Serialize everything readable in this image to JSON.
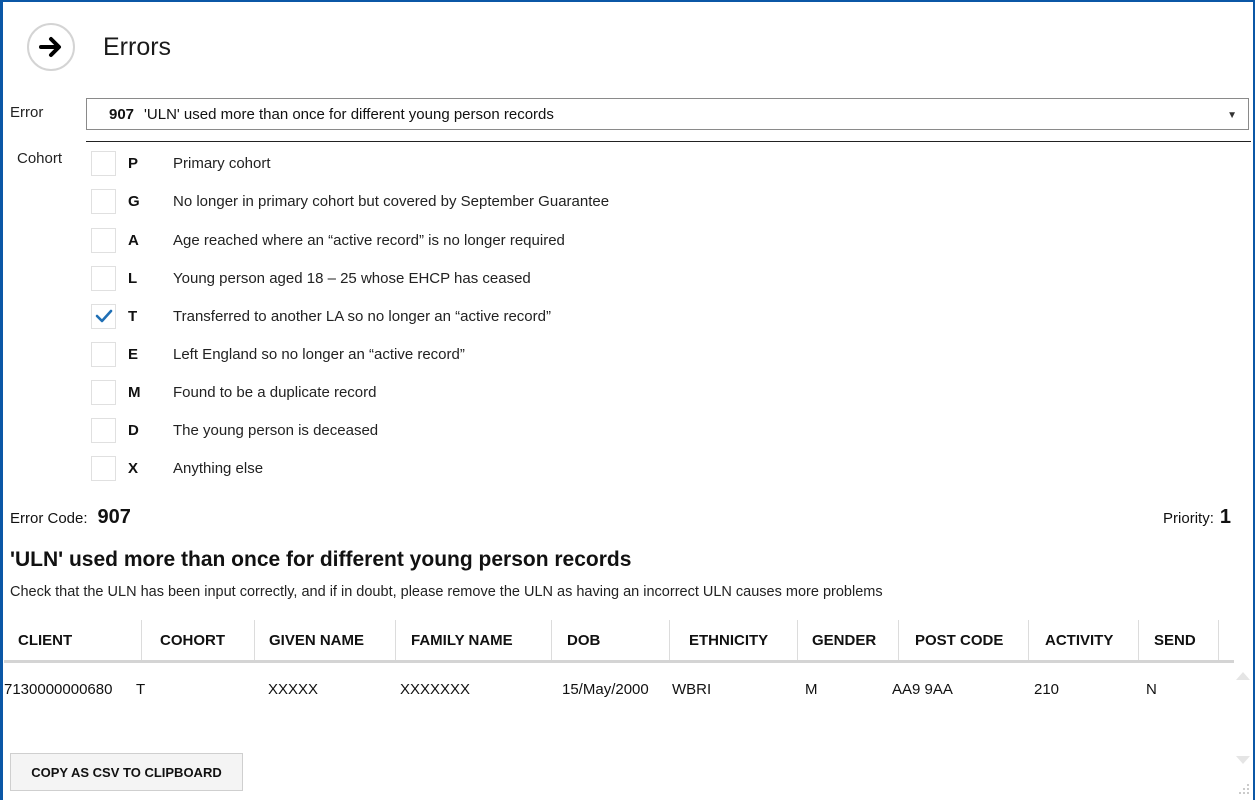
{
  "header": {
    "title": "Errors"
  },
  "error_field": {
    "label": "Error",
    "code": "907",
    "text": "'ULN' used more than once for different young person records"
  },
  "cohort": {
    "label": "Cohort",
    "items": [
      {
        "code": "P",
        "desc": "Primary cohort",
        "checked": false
      },
      {
        "code": "G",
        "desc": "No longer in primary cohort but covered by September Guarantee",
        "checked": false
      },
      {
        "code": "A",
        "desc": "Age reached where an “active record” is no longer required",
        "checked": false
      },
      {
        "code": "L",
        "desc": "Young person aged 18 – 25 whose EHCP has ceased",
        "checked": false
      },
      {
        "code": "T",
        "desc": "Transferred to another LA so no longer an “active record”",
        "checked": true
      },
      {
        "code": "E",
        "desc": "Left England so no longer an “active record”",
        "checked": false
      },
      {
        "code": "M",
        "desc": "Found to be a duplicate record",
        "checked": false
      },
      {
        "code": "D",
        "desc": "The young person is deceased",
        "checked": false
      },
      {
        "code": "X",
        "desc": "Anything else",
        "checked": false
      }
    ]
  },
  "details": {
    "error_code_label": "Error Code:",
    "error_code_value": "907",
    "priority_label": "Priority:",
    "priority_value": "1",
    "heading": "'ULN' used more than once for different young person records",
    "description": "Check that the ULN has been input correctly, and if in doubt, please remove the ULN as having an incorrect ULN causes more problems"
  },
  "table": {
    "columns": [
      "CLIENT",
      "COHORT",
      "GIVEN NAME",
      "FAMILY NAME",
      "DOB",
      "ETHNICITY",
      "GENDER",
      "POST CODE",
      "ACTIVITY",
      "SEND"
    ],
    "rows": [
      [
        "7130000000680",
        "T",
        "XXXXX",
        "XXXXXXX",
        "15/May/2000",
        "WBRI",
        "M",
        "AA9 9AA",
        "210",
        "N"
      ]
    ]
  },
  "actions": {
    "copy_label": "COPY AS CSV TO CLIPBOARD"
  },
  "colors": {
    "frame": "#0b57a6",
    "check": "#1f6fb5"
  },
  "icons": {
    "back": "arrow-right-circle-icon",
    "dropdown": "caret-down-icon",
    "check": "checkmark-icon",
    "grip": "resize-grip-icon"
  }
}
